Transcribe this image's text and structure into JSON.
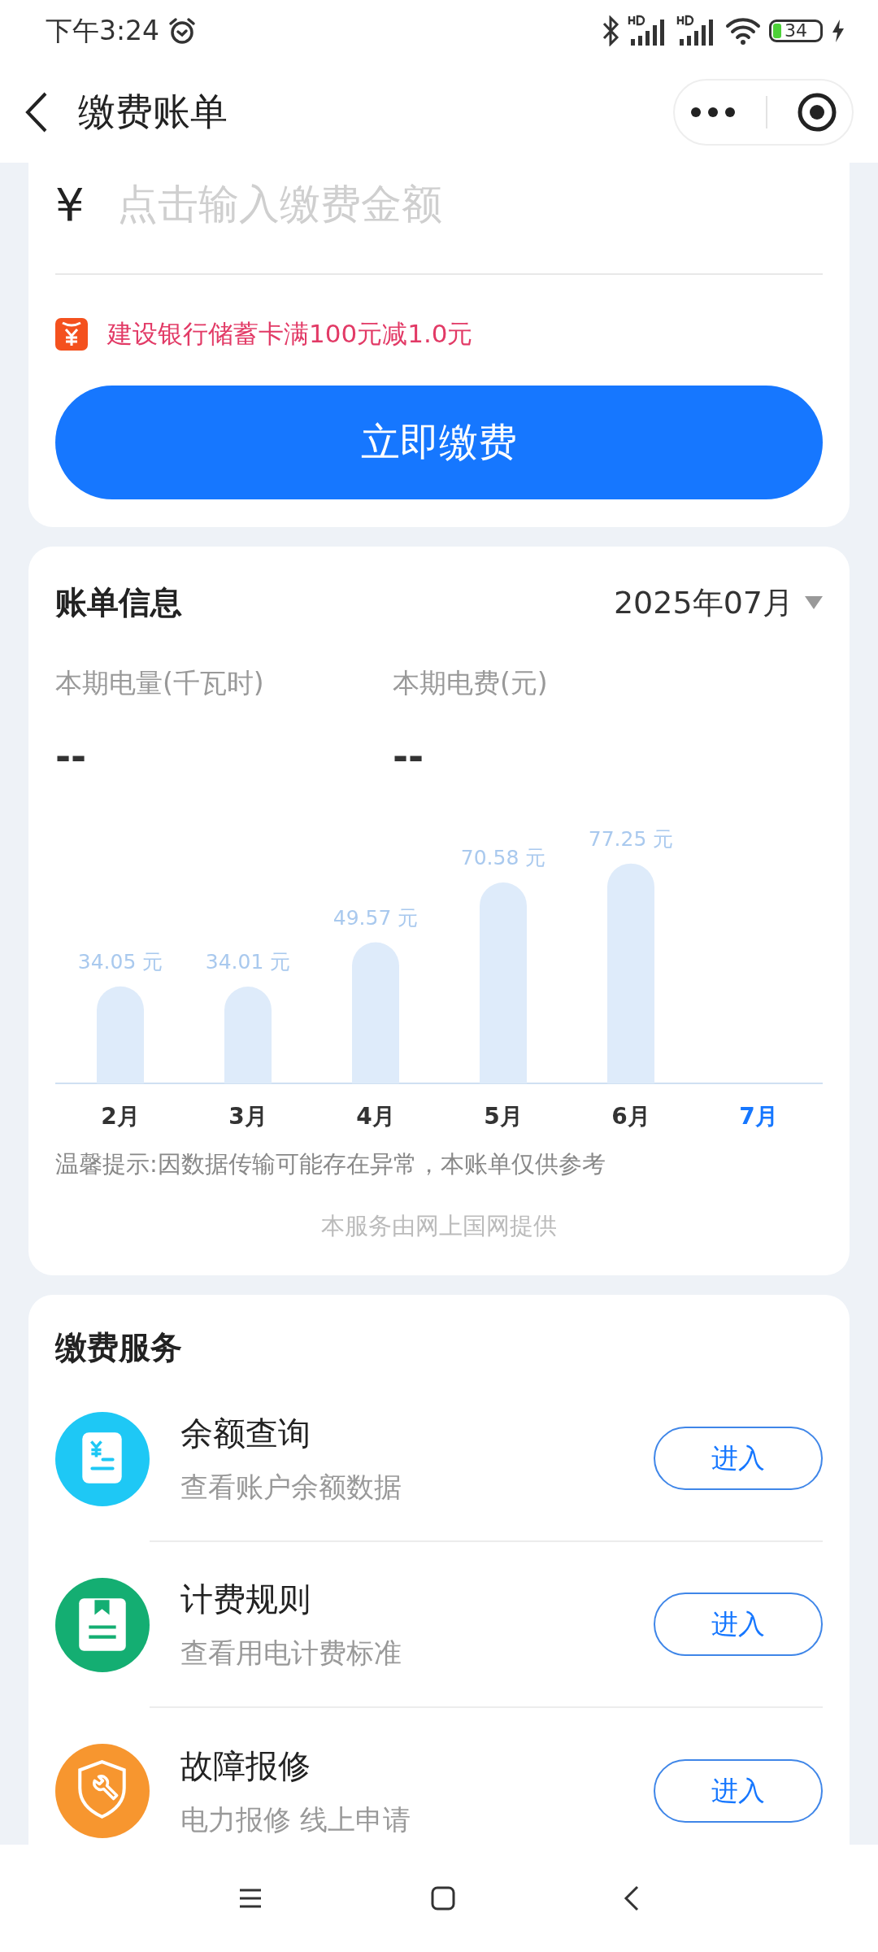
{
  "status_bar": {
    "time": "下午3:24",
    "battery": "34"
  },
  "nav": {
    "title": "缴费账单"
  },
  "payment": {
    "currency": "¥",
    "placeholder": "点击输入缴费金额",
    "promo": "建设银行储蓄卡满100元减1.0元",
    "pay_button": "立即缴费"
  },
  "bill": {
    "title": "账单信息",
    "period": "2025年07月",
    "stats": [
      {
        "label": "本期电量(千瓦时)",
        "value": "--"
      },
      {
        "label": "本期电费(元)",
        "value": "--"
      }
    ],
    "chart_data": {
      "type": "bar",
      "categories": [
        "2月",
        "3月",
        "4月",
        "5月",
        "6月",
        "7月"
      ],
      "values": [
        34.05,
        34.01,
        49.57,
        70.58,
        77.25,
        null
      ],
      "data_labels": true,
      "value_labels": [
        "34.05 元",
        "34.01 元",
        "49.57 元",
        "70.58 元",
        "77.25 元",
        null
      ]
    },
    "month_selected": [
      false,
      false,
      false,
      false,
      false,
      true
    ],
    "notice": "温馨提示:因数据传输可能存在异常，本账单仅供参考",
    "provider": "本服务由网上国网提供"
  },
  "services": {
    "title": "缴费服务",
    "items": [
      {
        "kind": "balance",
        "color": "#1ec8f5",
        "title": "余额查询",
        "subtitle": "查看账户余额数据",
        "button": "进入"
      },
      {
        "kind": "rules",
        "color": "#14ae72",
        "title": "计费规则",
        "subtitle": "查看用电计费标准",
        "button": "进入"
      },
      {
        "kind": "repair",
        "color": "#f7962f",
        "title": "故障报修",
        "subtitle": "电力报修 线上申请",
        "button": "进入"
      }
    ]
  }
}
